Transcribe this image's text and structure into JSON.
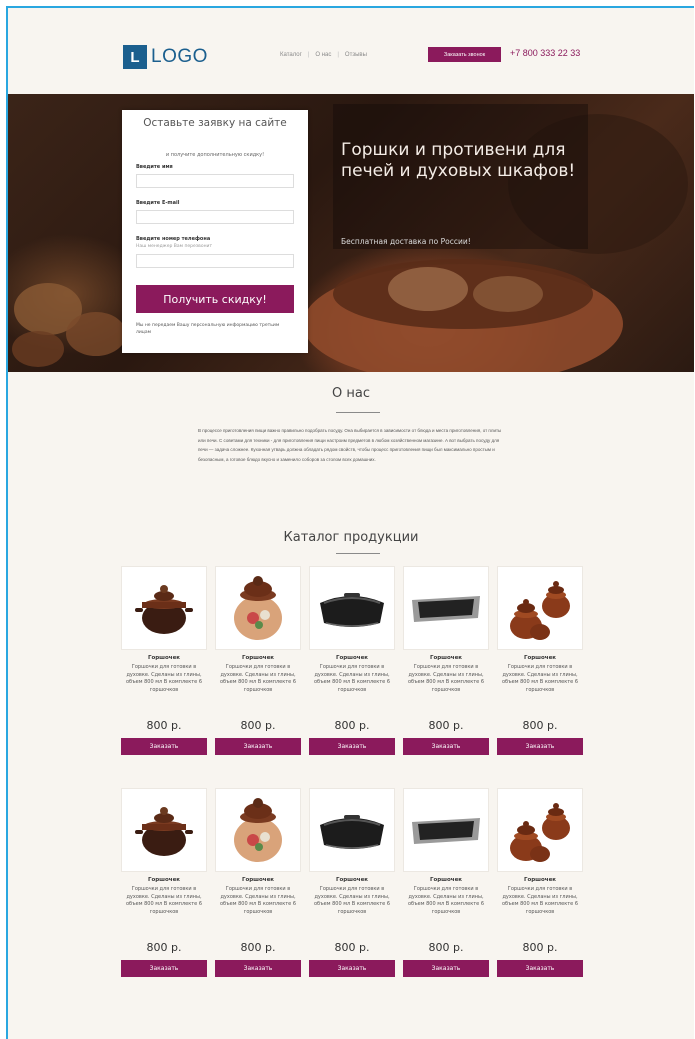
{
  "header": {
    "logo_mark": "L",
    "logo_text": "LOGO",
    "nav": [
      "Каталог",
      "О нас",
      "Отзывы"
    ],
    "callback_label": "Заказать звонок",
    "phone": "+7 800 333 22 33"
  },
  "hero": {
    "title": "Горшки и противени для печей и духовых шкафов!",
    "subtitle": "Бесплатная доставка по России!"
  },
  "form": {
    "title": "Оставьте заявку на сайте",
    "subtitle": "и получите дополнительную скидку!",
    "name_label": "Введите имя",
    "email_label": "Введите E-mail",
    "phone_label": "Введите номер телефона",
    "phone_hint": "Наш менеджер Вам перезвонит",
    "submit_label": "Получить скидку!",
    "note": "Мы не передаем Вашу персональную информацию третьим лицам"
  },
  "about": {
    "title": "О нас",
    "text": "В процессе приготовления пищи важно правильно подобрать посуду. Она выбирается в зависимости от блюда и места приготовления, от плиты или печи. С советами для техники - для приготовления пищи настроим предметов в любом хозяйственном магазине. А вот выбрать посуду для печи — задача сложнее. Кухонная утварь должна обладать рядом свойств, чтобы процесс приготовления пищи был максимально простым и безопасным, а готовое блюдо вкусно и заменило соборов за столом всех домашних."
  },
  "catalog": {
    "title": "Каталог продукции",
    "rows": [
      [
        {
          "image": "clay-pot-dark-icon",
          "name": "Горшочек",
          "desc": "Горшочки для готовки в духовке. Сделаны из глины, объем 800 мл В комплекте 6 горшочков",
          "price": "800 р.",
          "button": "Заказать"
        },
        {
          "image": "clay-pot-painted-icon",
          "name": "Горшочек",
          "desc": "Горшочки для готовки в духовке. Сделаны из глины, объем 800 мл В комплекте 6 горшочков",
          "price": "800 р.",
          "button": "Заказать"
        },
        {
          "image": "roasting-pan-lid-icon",
          "name": "Горшочек",
          "desc": "Горшочки для готовки в духовке. Сделаны из глины, объем 800 мл В комплекте 6 горшочков",
          "price": "800 р.",
          "button": "Заказать"
        },
        {
          "image": "baking-tray-icon",
          "name": "Горшочек",
          "desc": "Горшочки для готовки в духовке. Сделаны из глины, объем 800 мл В комплекте 6 горшочков",
          "price": "800 р.",
          "button": "Заказать"
        },
        {
          "image": "clay-pots-set-icon",
          "name": "Горшочек",
          "desc": "Горшочки для готовки в духовке. Сделаны из глины, объем 800 мл В комплекте 6 горшочков",
          "price": "800 р.",
          "button": "Заказать"
        }
      ],
      [
        {
          "image": "clay-pot-dark-icon",
          "name": "Горшочек",
          "desc": "Горшочки для готовки в духовке. Сделаны из глины, объем 800 мл В комплекте 6 горшочков",
          "price": "800 р.",
          "button": "Заказать"
        },
        {
          "image": "clay-pot-painted-icon",
          "name": "Горшочек",
          "desc": "Горшочки для готовки в духовке. Сделаны из глины, объем 800 мл В комплекте 6 горшочков",
          "price": "800 р.",
          "button": "Заказать"
        },
        {
          "image": "roasting-pan-lid-icon",
          "name": "Горшочек",
          "desc": "Горшочки для готовки в духовке. Сделаны из глины, объем 800 мл В комплекте 6 горшочков",
          "price": "800 р.",
          "button": "Заказать"
        },
        {
          "image": "baking-tray-icon",
          "name": "Горшочек",
          "desc": "Горшочки для готовки в духовке. Сделаны из глины, объем 800 мл В комплекте 6 горшочков",
          "price": "800 р.",
          "button": "Заказать"
        },
        {
          "image": "clay-pots-set-icon",
          "name": "Горшочек",
          "desc": "Горшочки для готовки в духовке. Сделаны из глины, объем 800 мл В комплекте 6 горшочков",
          "price": "800 р.",
          "button": "Заказать"
        }
      ]
    ]
  },
  "colors": {
    "accent": "#8b1a5c",
    "brand": "#1b5f8e",
    "frame": "#2aa7e0",
    "background": "#f8f5f0"
  }
}
